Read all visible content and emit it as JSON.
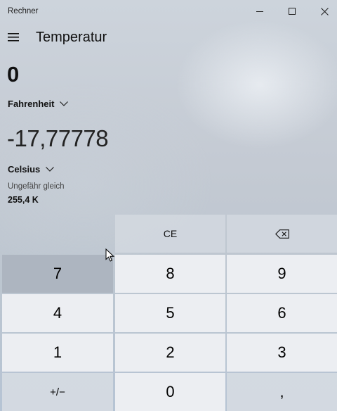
{
  "window": {
    "title": "Rechner",
    "controls": [
      "minimize-icon",
      "maximize-icon",
      "close-icon"
    ]
  },
  "header": {
    "menu_icon": "hamburger-icon",
    "mode_title": "Temperatur"
  },
  "converter": {
    "from_value": "0",
    "from_unit": "Fahrenheit",
    "to_value": "-17,77778",
    "to_unit": "Celsius",
    "approx_label": "Ungefähr gleich",
    "approx_value": "255,4 K"
  },
  "keypad": {
    "ce": "CE",
    "backspace_icon": "backspace-icon",
    "digits": {
      "7": "7",
      "8": "8",
      "9": "9",
      "4": "4",
      "5": "5",
      "6": "6",
      "1": "1",
      "2": "2",
      "3": "3",
      "0": "0"
    },
    "plus_minus": "+/−",
    "decimal": ","
  },
  "colors": {
    "background": "#c4cad3",
    "key_light": "#eceef2",
    "key_pressed": "#adb5c0"
  }
}
